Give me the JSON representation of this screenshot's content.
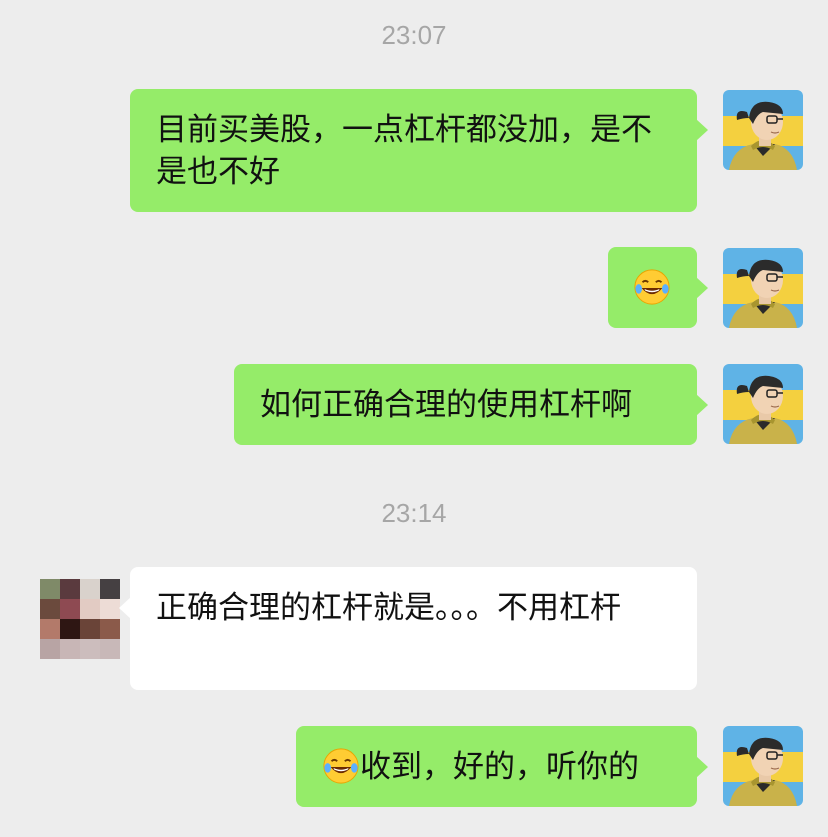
{
  "chat": {
    "timestamps": [
      "23:07",
      "23:14"
    ],
    "messages": [
      {
        "side": "out",
        "text": "目前买美股，一点杠杆都没加，是不是也不好"
      },
      {
        "side": "out",
        "emoji": "laughing-tears"
      },
      {
        "side": "out",
        "text": "如何正确合理的使用杠杆啊"
      },
      {
        "side": "in",
        "text": "正确合理的杠杆就是。。。不用杠杆"
      },
      {
        "side": "out",
        "emoji": "laughing-tears",
        "text": "收到，好的，听你的"
      }
    ]
  },
  "colors": {
    "background": "#ededed",
    "outgoing_bubble": "#95ec69",
    "incoming_bubble": "#ffffff",
    "timestamp": "#a6a6a6"
  },
  "icons": {
    "self_avatar": "illustrated-man-avatar",
    "other_avatar": "pixelated-avatar",
    "emoji": "face-with-tears-of-joy"
  }
}
